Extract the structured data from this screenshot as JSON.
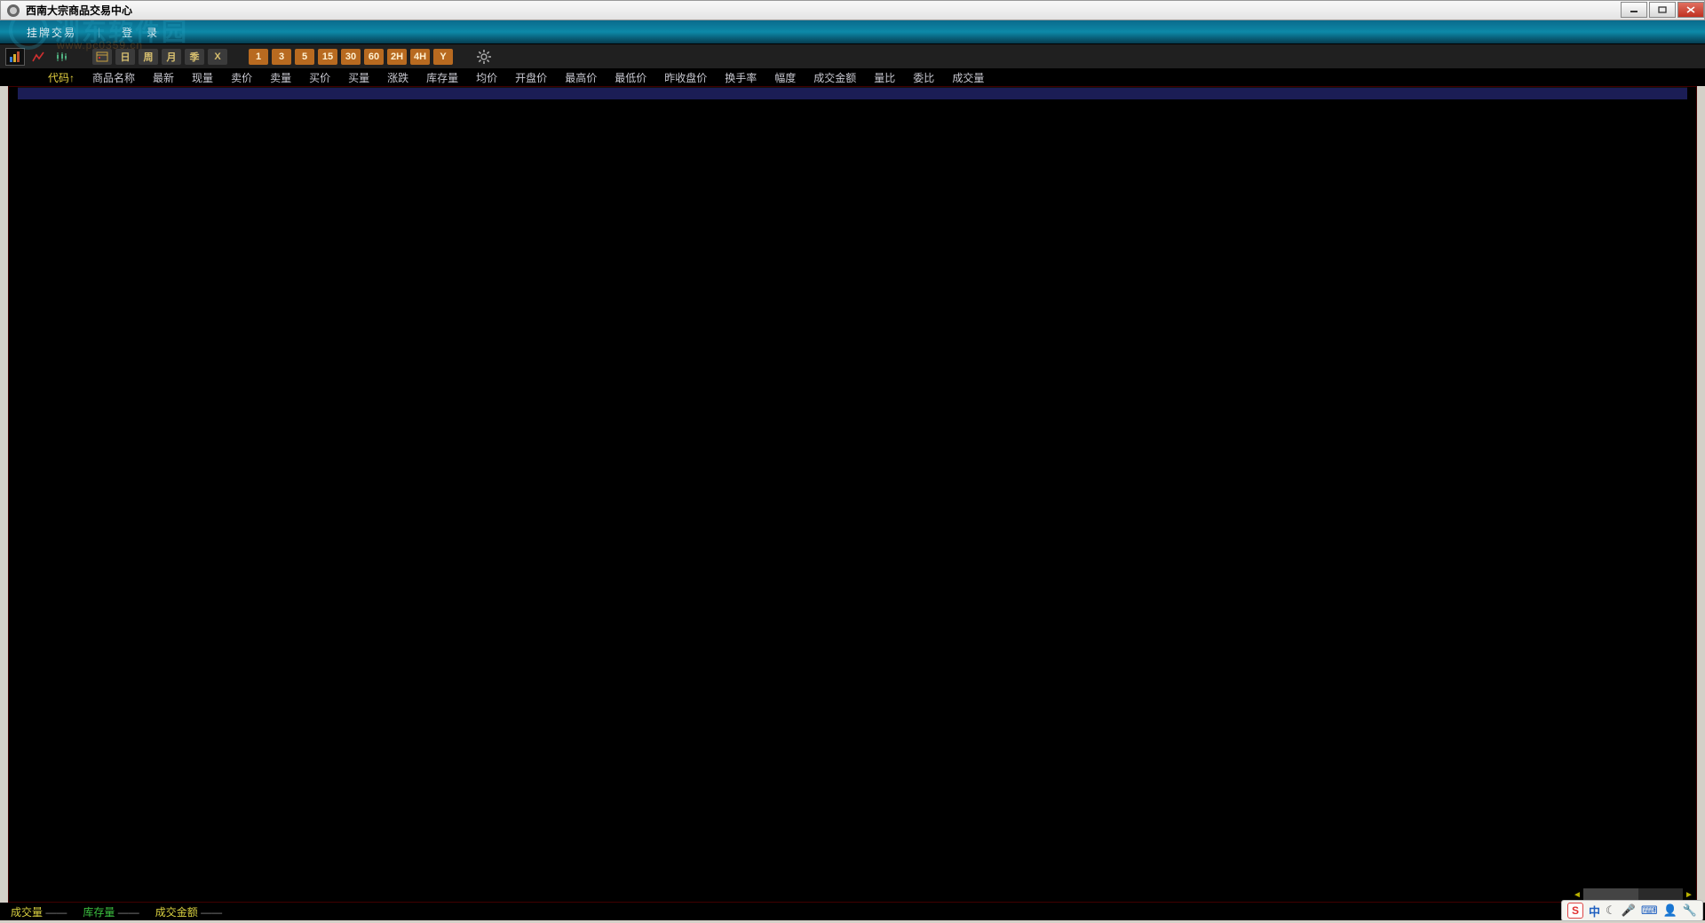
{
  "window": {
    "title": "西南大宗商品交易中心"
  },
  "menu": {
    "trade": "挂牌交易",
    "login": "登　录"
  },
  "toolbar": {
    "period_buttons_gray": [
      "日",
      "周",
      "月",
      "季",
      "X"
    ],
    "period_buttons_orange": [
      "1",
      "3",
      "5",
      "15",
      "30",
      "60",
      "2H",
      "4H",
      "Y"
    ]
  },
  "columns": [
    "代码↑",
    "商品名称",
    "最新",
    "现量",
    "卖价",
    "卖量",
    "买价",
    "买量",
    "涨跌",
    "库存量",
    "均价",
    "开盘价",
    "最高价",
    "最低价",
    "昨收盘价",
    "换手率",
    "幅度",
    "成交金额",
    "量比",
    "委比",
    "成交量"
  ],
  "status": {
    "volume_label": "成交量",
    "inventory_label": "库存量",
    "turnover_label": "成交金额",
    "dash": "——"
  },
  "ime": {
    "sogou": "S",
    "zhong": "中"
  },
  "watermark": {
    "text": "洲东软件园",
    "sub": "www.pc0359.cn"
  }
}
